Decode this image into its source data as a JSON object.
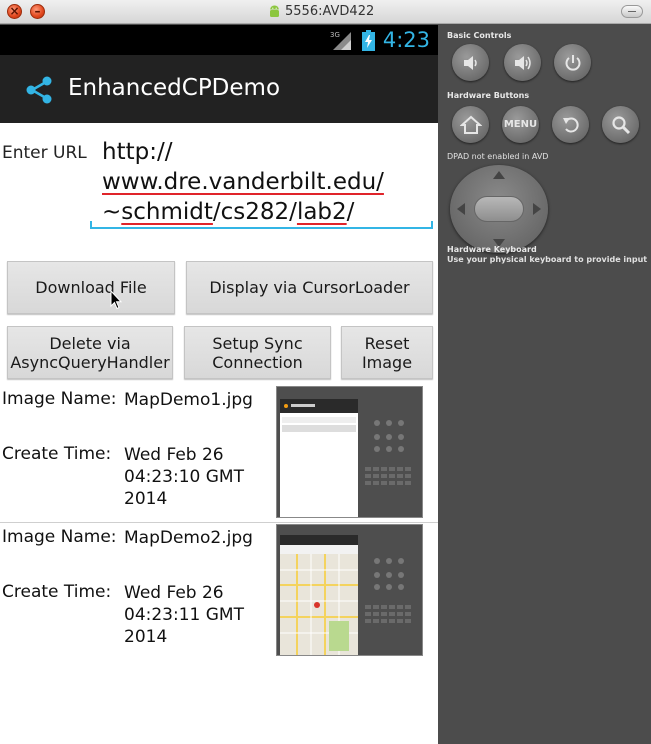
{
  "window": {
    "title": "5556:AVD422",
    "close_symbol": "×",
    "minimize_symbol": "–"
  },
  "device": {
    "status": {
      "network": "3G",
      "time": "4:23"
    },
    "action_bar": {
      "title": "EnhancedCPDemo",
      "icon": "share-icon"
    },
    "url": {
      "label": "Enter URL",
      "line1": "http://",
      "line2": "www.dre.vanderbilt.edu/",
      "line3_a": "~",
      "line3_b": "schmidt",
      "line3_c": "/cs282/",
      "line3_d": "lab2",
      "line3_e": "/"
    },
    "buttons": {
      "download": "Download File",
      "display": "Display via CursorLoader",
      "delete_1": "Delete via",
      "delete_2": "AsyncQueryHandler",
      "sync_1": "Setup Sync",
      "sync_2": "Connection",
      "reset_1": "Reset",
      "reset_2": "Image"
    },
    "images": [
      {
        "name_label": "Image Name:",
        "name": "MapDemo1.jpg",
        "time_label": "Create Time:",
        "time_1": "Wed Feb 26",
        "time_2": "04:23:10 GMT",
        "time_3": "2014"
      },
      {
        "name_label": "Image Name:",
        "name": "MapDemo2.jpg",
        "time_label": "Create Time:",
        "time_1": "Wed Feb 26",
        "time_2": "04:23:11 GMT",
        "time_3": "2014"
      }
    ]
  },
  "panel": {
    "basic_controls": "Basic Controls",
    "hardware_buttons": "Hardware Buttons",
    "menu_label": "MENU",
    "dpad_note": "DPAD not enabled in AVD",
    "keyboard_title": "Hardware Keyboard",
    "keyboard_note": "Use your physical keyboard to provide input"
  },
  "colors": {
    "accent": "#33b5e5",
    "action_bar": "#222222",
    "panel": "#4c4c4c",
    "spell_underline": "#e0242a"
  }
}
